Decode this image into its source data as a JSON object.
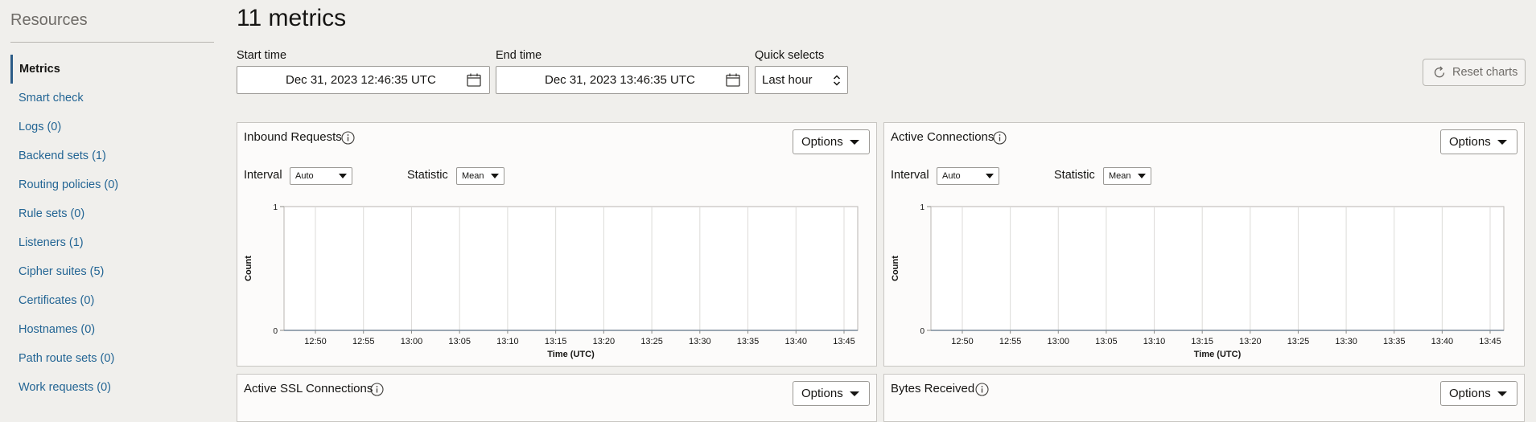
{
  "sidebar": {
    "title": "Resources",
    "items": [
      {
        "label": "Metrics",
        "active": true
      },
      {
        "label": "Smart check"
      },
      {
        "label": "Logs (0)"
      },
      {
        "label": "Backend sets (1)"
      },
      {
        "label": "Routing policies (0)"
      },
      {
        "label": "Rule sets (0)"
      },
      {
        "label": "Listeners (1)"
      },
      {
        "label": "Cipher suites (5)"
      },
      {
        "label": "Certificates (0)"
      },
      {
        "label": "Hostnames (0)"
      },
      {
        "label": "Path route sets (0)"
      },
      {
        "label": "Work requests (0)"
      }
    ]
  },
  "header": {
    "title": "11 metrics",
    "start_label": "Start time",
    "start_value": "Dec 31, 2023 12:46:35 UTC",
    "end_label": "End time",
    "end_value": "Dec 31, 2023 13:46:35 UTC",
    "quick_label": "Quick selects",
    "quick_value": "Last hour",
    "reset_label": "Reset charts"
  },
  "panels": [
    {
      "title": "Inbound Requests",
      "options": "Options",
      "interval_label": "Interval",
      "interval_value": "Auto",
      "statistic_label": "Statistic",
      "statistic_value": "Mean"
    },
    {
      "title": "Active Connections",
      "options": "Options",
      "interval_label": "Interval",
      "interval_value": "Auto",
      "statistic_label": "Statistic",
      "statistic_value": "Mean"
    },
    {
      "title": "Active SSL Connections",
      "options": "Options"
    },
    {
      "title": "Bytes Received",
      "options": "Options"
    }
  ],
  "chart_data": [
    {
      "type": "line",
      "ylabel": "Count",
      "xlabel": "Time (UTC)",
      "ylim": [
        0,
        1
      ],
      "yticks": [
        "1",
        "0"
      ],
      "x": [
        "12:50",
        "12:55",
        "13:00",
        "13:05",
        "13:10",
        "13:15",
        "13:20",
        "13:25",
        "13:30",
        "13:35",
        "13:40",
        "13:45"
      ],
      "series": [],
      "grid": true
    },
    {
      "type": "line",
      "ylabel": "Count",
      "xlabel": "Time (UTC)",
      "ylim": [
        0,
        1
      ],
      "yticks": [
        "1",
        "0"
      ],
      "x": [
        "12:50",
        "12:55",
        "13:00",
        "13:05",
        "13:10",
        "13:15",
        "13:20",
        "13:25",
        "13:30",
        "13:35",
        "13:40",
        "13:45"
      ],
      "series": [],
      "grid": true
    }
  ],
  "colors": {
    "link": "#236594",
    "active_bar": "#2c5c87",
    "grid": "#c8c6c2"
  }
}
